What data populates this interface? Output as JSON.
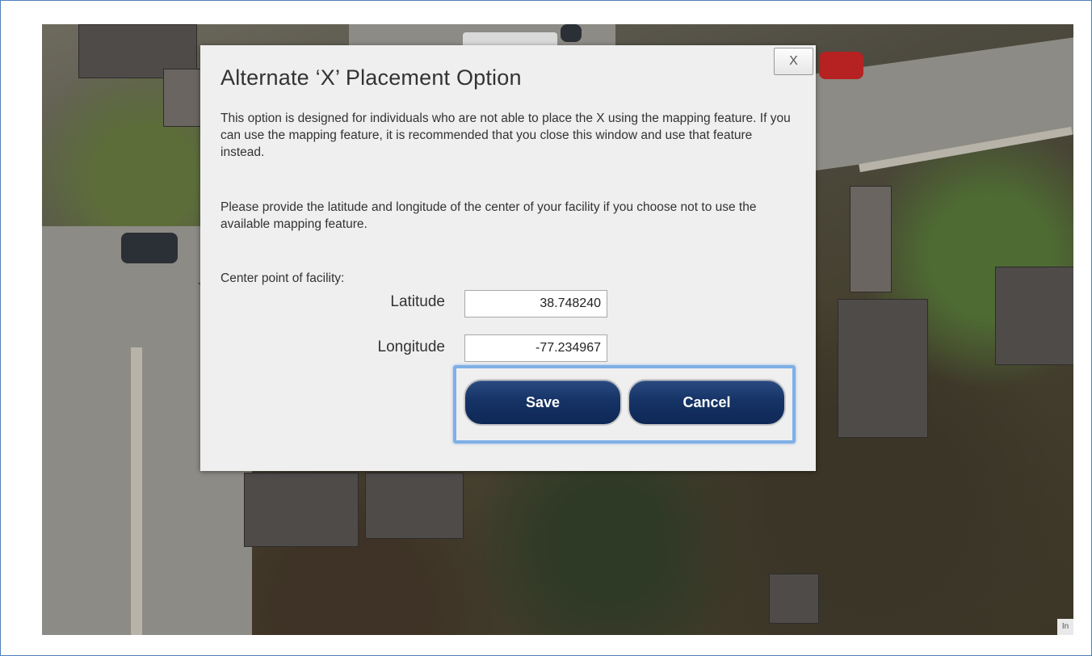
{
  "dialog": {
    "title": "Alternate ‘X’ Placement Option",
    "close_label": "X",
    "paragraph1": "This option is designed for individuals who are not able to place the X using the mapping feature. If you can use the mapping feature, it is recommended that you close this window and use that feature instead.",
    "paragraph2": "Please provide the latitude and longitude of the center of your facility if you choose not to use the available mapping feature.",
    "center_point_label": "Center point of facility:",
    "latitude_label": "Latitude",
    "latitude_value": "38.748240",
    "longitude_label": "Longitude",
    "longitude_value": "-77.234967",
    "save_label": "Save",
    "cancel_label": "Cancel"
  },
  "map": {
    "corner_text": "In"
  },
  "colors": {
    "button_navy": "#163366",
    "highlight_blue": "#7fb0e6",
    "frame_border": "#4f81bd",
    "dialog_bg": "#efefef"
  }
}
